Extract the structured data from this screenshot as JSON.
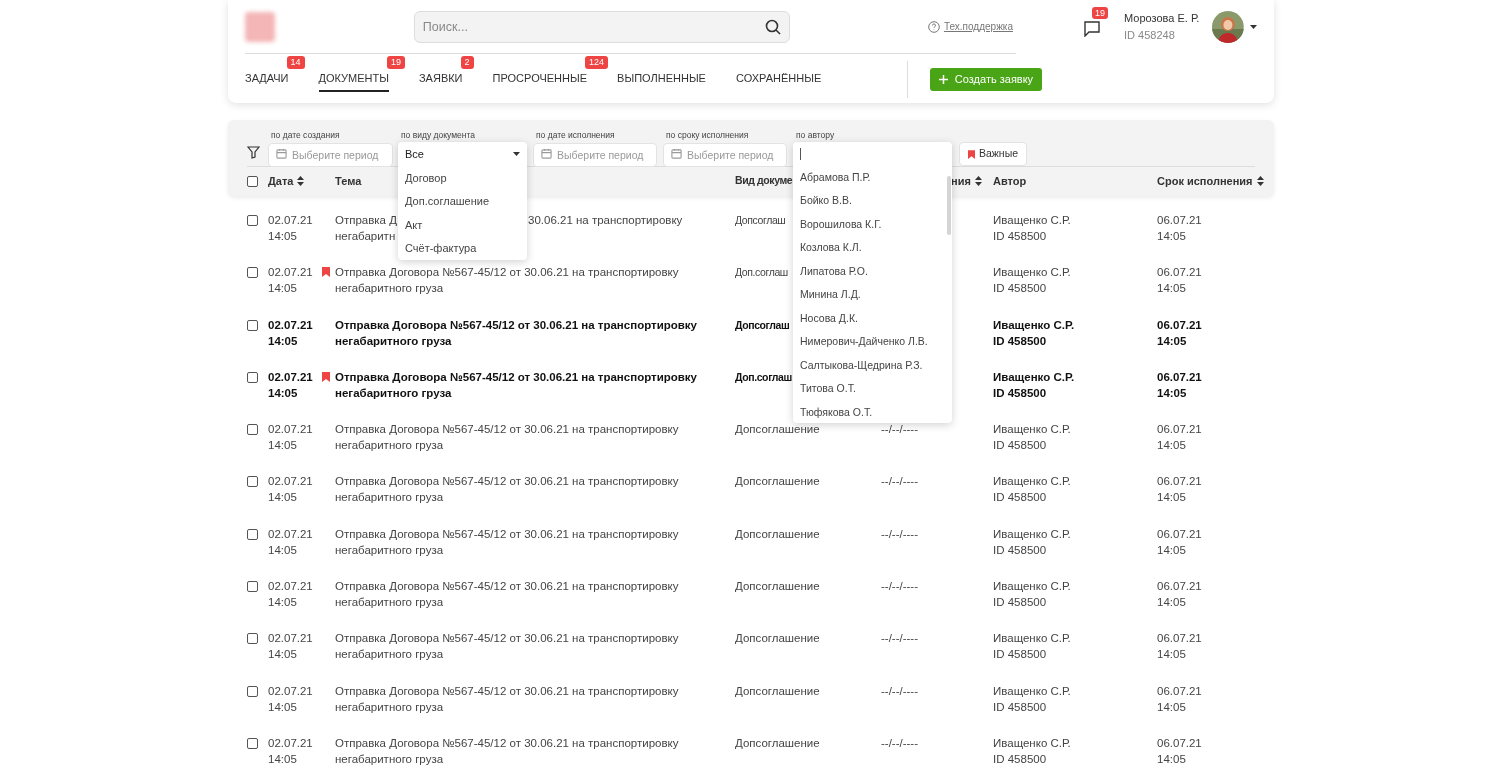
{
  "header": {
    "search": {
      "placeholder": "Поиск..."
    },
    "support_link": "Тех.поддержка",
    "messages_badge": "19",
    "user": {
      "name": "Морозова Е. Р.",
      "id": "ID 458248"
    }
  },
  "tabs": [
    {
      "label": "ЗАДАЧИ",
      "badge": "14",
      "selected": false
    },
    {
      "label": "ДОКУМЕНТЫ",
      "badge": "19",
      "selected": true
    },
    {
      "label": "ЗАЯВКИ",
      "badge": "2",
      "selected": false
    },
    {
      "label": "ПРОСРОЧЕННЫЕ",
      "badge": "124",
      "selected": false
    },
    {
      "label": "ВЫПОЛНЕННЫЕ",
      "selected": false
    },
    {
      "label": "СОХРАНЁННЫЕ",
      "selected": false
    }
  ],
  "create_button": "Создать заявку",
  "filters": [
    {
      "kind": "period",
      "label": "по дате создания",
      "placeholder": "Выберите период"
    },
    {
      "kind": "select",
      "label": "по виду документа",
      "value": "Все",
      "options": [
        "Договор",
        "Доп.соглашение",
        "Акт",
        "Счёт-фактура"
      ]
    },
    {
      "kind": "period",
      "label": "по дате исполнения",
      "placeholder": "Выберите период"
    },
    {
      "kind": "period",
      "label": "по сроку исполнения",
      "placeholder": "Выберите период"
    },
    {
      "kind": "search",
      "label": "по автору",
      "options": [
        "Абрамова П.Р.",
        "Бойко В.В.",
        "Ворошилова К.Г.",
        "Козлова К.Л.",
        "Липатова Р.О.",
        "Минина Л.Д.",
        "Носова Д.К.",
        "Нимерович-Дайченко Л.В.",
        "Салтыкова-Щедрина Р.З.",
        "Титова О.Т.",
        "Тюфякова О.Т."
      ]
    }
  ],
  "important_button": "Важные",
  "table": {
    "select_all_checked": false,
    "columns": [
      {
        "label": "Дата",
        "sortable": true
      },
      {
        "label": "Тема",
        "sortable": false
      },
      {
        "label": "Вид докуме",
        "sortable": false
      },
      {
        "label": "ния",
        "sortable": true
      },
      {
        "label": "Автор",
        "sortable": false
      },
      {
        "label": "Срок исполнения",
        "sortable": true
      }
    ],
    "rows": [
      {
        "checked": false,
        "bookmarked": false,
        "unread": false,
        "date": "02.07.21",
        "time": "14:05",
        "subject_fragments": [
          "Отправка Д",
          "30.06.21 на транспортировку",
          "негабаритн"
        ],
        "doc_type": "Допсоглаш",
        "author": "Иващенко С.Р.",
        "author_id": "ID 458500",
        "deadline_date": "06.07.21",
        "deadline_time": "14:05"
      },
      {
        "checked": false,
        "bookmarked": true,
        "unread": false,
        "date": "02.07.21",
        "time": "14:05",
        "subject": "Отправка Договора №567-45/12 от 30.06.21 на транспортировку негабаритного груза",
        "doc_type": "Доп.соглаш",
        "author": "Иващенко С.Р.",
        "author_id": "ID 458500",
        "deadline_date": "06.07.21",
        "deadline_time": "14:05"
      },
      {
        "checked": false,
        "bookmarked": false,
        "unread": true,
        "date": "02.07.21",
        "time": "14:05",
        "subject": "Отправка Договора №567-45/12 от 30.06.21 на транспортировку негабаритного груза",
        "doc_type": "Допсоглаш",
        "author": "Иващенко С.Р.",
        "author_id": "ID 458500",
        "deadline_date": "06.07.21",
        "deadline_time": "14:05"
      },
      {
        "checked": false,
        "bookmarked": true,
        "unread": true,
        "date": "02.07.21",
        "time": "14:05",
        "subject": "Отправка Договора №567-45/12 от 30.06.21 на транспортировку негабаритного груза",
        "doc_type": "Доп.соглаш",
        "author": "Иващенко С.Р.",
        "author_id": "ID 458500",
        "deadline_date": "06.07.21",
        "deadline_time": "14:05"
      },
      {
        "checked": false,
        "bookmarked": false,
        "unread": false,
        "date": "02.07.21",
        "time": "14:05",
        "subject": "Отправка Договора №567-45/12 от 30.06.21 на транспортировку негабаритного груза",
        "doc_type": "Допсоглашение",
        "due_date": "--/--/----",
        "author": "Иващенко С.Р.",
        "author_id": "ID 458500",
        "deadline_date": "06.07.21",
        "deadline_time": "14:05"
      },
      {
        "checked": false,
        "bookmarked": false,
        "unread": false,
        "date": "02.07.21",
        "time": "14:05",
        "subject": "Отправка Договора №567-45/12 от 30.06.21 на транспортировку негабаритного груза",
        "doc_type": "Допсоглашение",
        "due_date": "--/--/----",
        "author": "Иващенко С.Р.",
        "author_id": "ID 458500",
        "deadline_date": "06.07.21",
        "deadline_time": "14:05"
      },
      {
        "checked": false,
        "bookmarked": false,
        "unread": false,
        "date": "02.07.21",
        "time": "14:05",
        "subject": "Отправка Договора №567-45/12 от 30.06.21 на транспортировку негабаритного груза",
        "doc_type": "Допсоглашение",
        "due_date": "--/--/----",
        "author": "Иващенко С.Р.",
        "author_id": "ID 458500",
        "deadline_date": "06.07.21",
        "deadline_time": "14:05"
      },
      {
        "checked": false,
        "bookmarked": false,
        "unread": false,
        "date": "02.07.21",
        "time": "14:05",
        "subject": "Отправка Договора №567-45/12 от 30.06.21 на транспортировку негабаритного груза",
        "doc_type": "Допсоглашение",
        "due_date": "--/--/----",
        "author": "Иващенко С.Р.",
        "author_id": "ID 458500",
        "deadline_date": "06.07.21",
        "deadline_time": "14:05"
      },
      {
        "checked": false,
        "bookmarked": false,
        "unread": false,
        "date": "02.07.21",
        "time": "14:05",
        "subject": "Отправка Договора №567-45/12 от 30.06.21 на транспортировку негабаритного груза",
        "doc_type": "Допсоглашение",
        "due_date": "--/--/----",
        "author": "Иващенко С.Р.",
        "author_id": "ID 458500",
        "deadline_date": "06.07.21",
        "deadline_time": "14:05"
      },
      {
        "checked": false,
        "bookmarked": false,
        "unread": false,
        "date": "02.07.21",
        "time": "14:05",
        "subject": "Отправка Договора №567-45/12 от 30.06.21 на транспортировку негабаритного груза",
        "doc_type": "Допсоглашение",
        "due_date": "--/--/----",
        "author": "Иващенко С.Р.",
        "author_id": "ID 458500",
        "deadline_date": "06.07.21",
        "deadline_time": "14:05"
      },
      {
        "checked": false,
        "bookmarked": false,
        "unread": false,
        "date": "02.07.21",
        "time": "14:05",
        "subject": "Отправка Договора №567-45/12 от 30.06.21 на транспортировку негабаритного груза",
        "doc_type": "Допсоглашение",
        "due_date": "--/--/----",
        "author": "Иващенко С.Р.",
        "author_id": "ID 458500",
        "deadline_date": "06.07.21",
        "deadline_time": "14:05"
      }
    ]
  }
}
